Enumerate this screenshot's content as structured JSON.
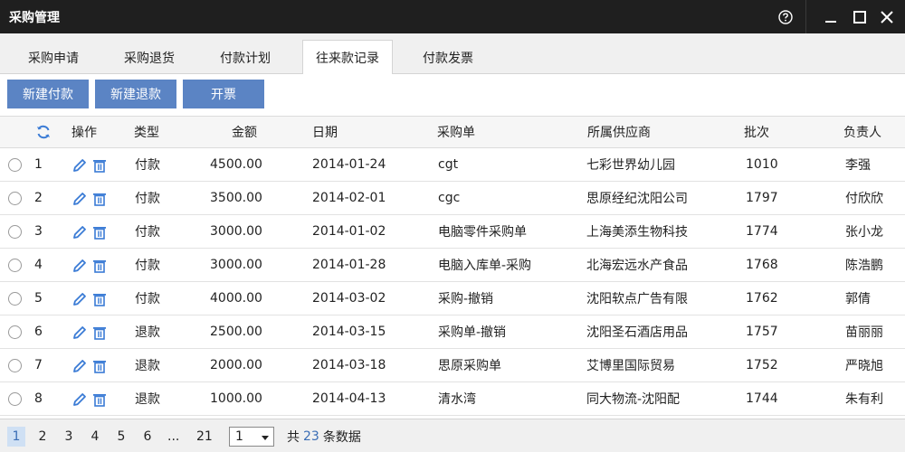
{
  "window": {
    "title": "采购管理"
  },
  "tabs": [
    {
      "label": "采购申请"
    },
    {
      "label": "采购退货"
    },
    {
      "label": "付款计划"
    },
    {
      "label": "往来款记录"
    },
    {
      "label": "付款发票"
    }
  ],
  "active_tab": 3,
  "toolbar": {
    "new_payment": "新建付款",
    "new_refund": "新建退款",
    "invoice": "开票"
  },
  "table": {
    "headers": {
      "op": "操作",
      "type": "类型",
      "amount": "金额",
      "date": "日期",
      "po": "采购单",
      "supplier": "所属供应商",
      "batch": "批次",
      "owner": "负责人"
    },
    "rows": [
      {
        "no": "1",
        "type": "付款",
        "amount": "4500.00",
        "date": "2014-01-24",
        "po": "cgt",
        "supplier": "七彩世界幼儿园",
        "batch": "1010",
        "owner": "李强"
      },
      {
        "no": "2",
        "type": "付款",
        "amount": "3500.00",
        "date": "2014-02-01",
        "po": "cgc",
        "supplier": "思原经纪沈阳公司",
        "batch": "1797",
        "owner": "付欣欣"
      },
      {
        "no": "3",
        "type": "付款",
        "amount": "3000.00",
        "date": "2014-01-02",
        "po": "电脑零件采购单",
        "supplier": "上海美添生物科技",
        "batch": "1774",
        "owner": "张小龙"
      },
      {
        "no": "4",
        "type": "付款",
        "amount": "3000.00",
        "date": "2014-01-28",
        "po": "电脑入库单-采购",
        "supplier": "北海宏远水产食品",
        "batch": "1768",
        "owner": "陈浩鹏"
      },
      {
        "no": "5",
        "type": "付款",
        "amount": "4000.00",
        "date": "2014-03-02",
        "po": "采购-撤销",
        "supplier": "沈阳软点广告有限",
        "batch": "1762",
        "owner": "郭倩"
      },
      {
        "no": "6",
        "type": "退款",
        "amount": "2500.00",
        "date": "2014-03-15",
        "po": "采购单-撤销",
        "supplier": "沈阳圣石酒店用品",
        "batch": "1757",
        "owner": "苗丽丽"
      },
      {
        "no": "7",
        "type": "退款",
        "amount": "2000.00",
        "date": "2014-03-18",
        "po": "思原采购单",
        "supplier": "艾博里国际贸易",
        "batch": "1752",
        "owner": "严晓旭"
      },
      {
        "no": "8",
        "type": "退款",
        "amount": "1000.00",
        "date": "2014-04-13",
        "po": "清水湾",
        "supplier": "同大物流-沈阳配",
        "batch": "1744",
        "owner": "朱有利"
      }
    ]
  },
  "pager": {
    "pages": [
      "1",
      "2",
      "3",
      "4",
      "5",
      "6",
      "...",
      "21"
    ],
    "current": "1",
    "select_value": "1",
    "total_prefix": "共",
    "total_count": "23",
    "total_suffix": "条数据"
  },
  "colors": {
    "accent": "#5b84c4",
    "titlebar": "#1f1f1f",
    "link": "#3a6db5"
  },
  "icons": {
    "help": "help-circle-icon",
    "minimize": "minimize-icon",
    "maximize": "maximize-icon",
    "close": "close-icon",
    "refresh": "refresh-icon",
    "edit": "pencil-icon",
    "delete": "trash-icon"
  }
}
